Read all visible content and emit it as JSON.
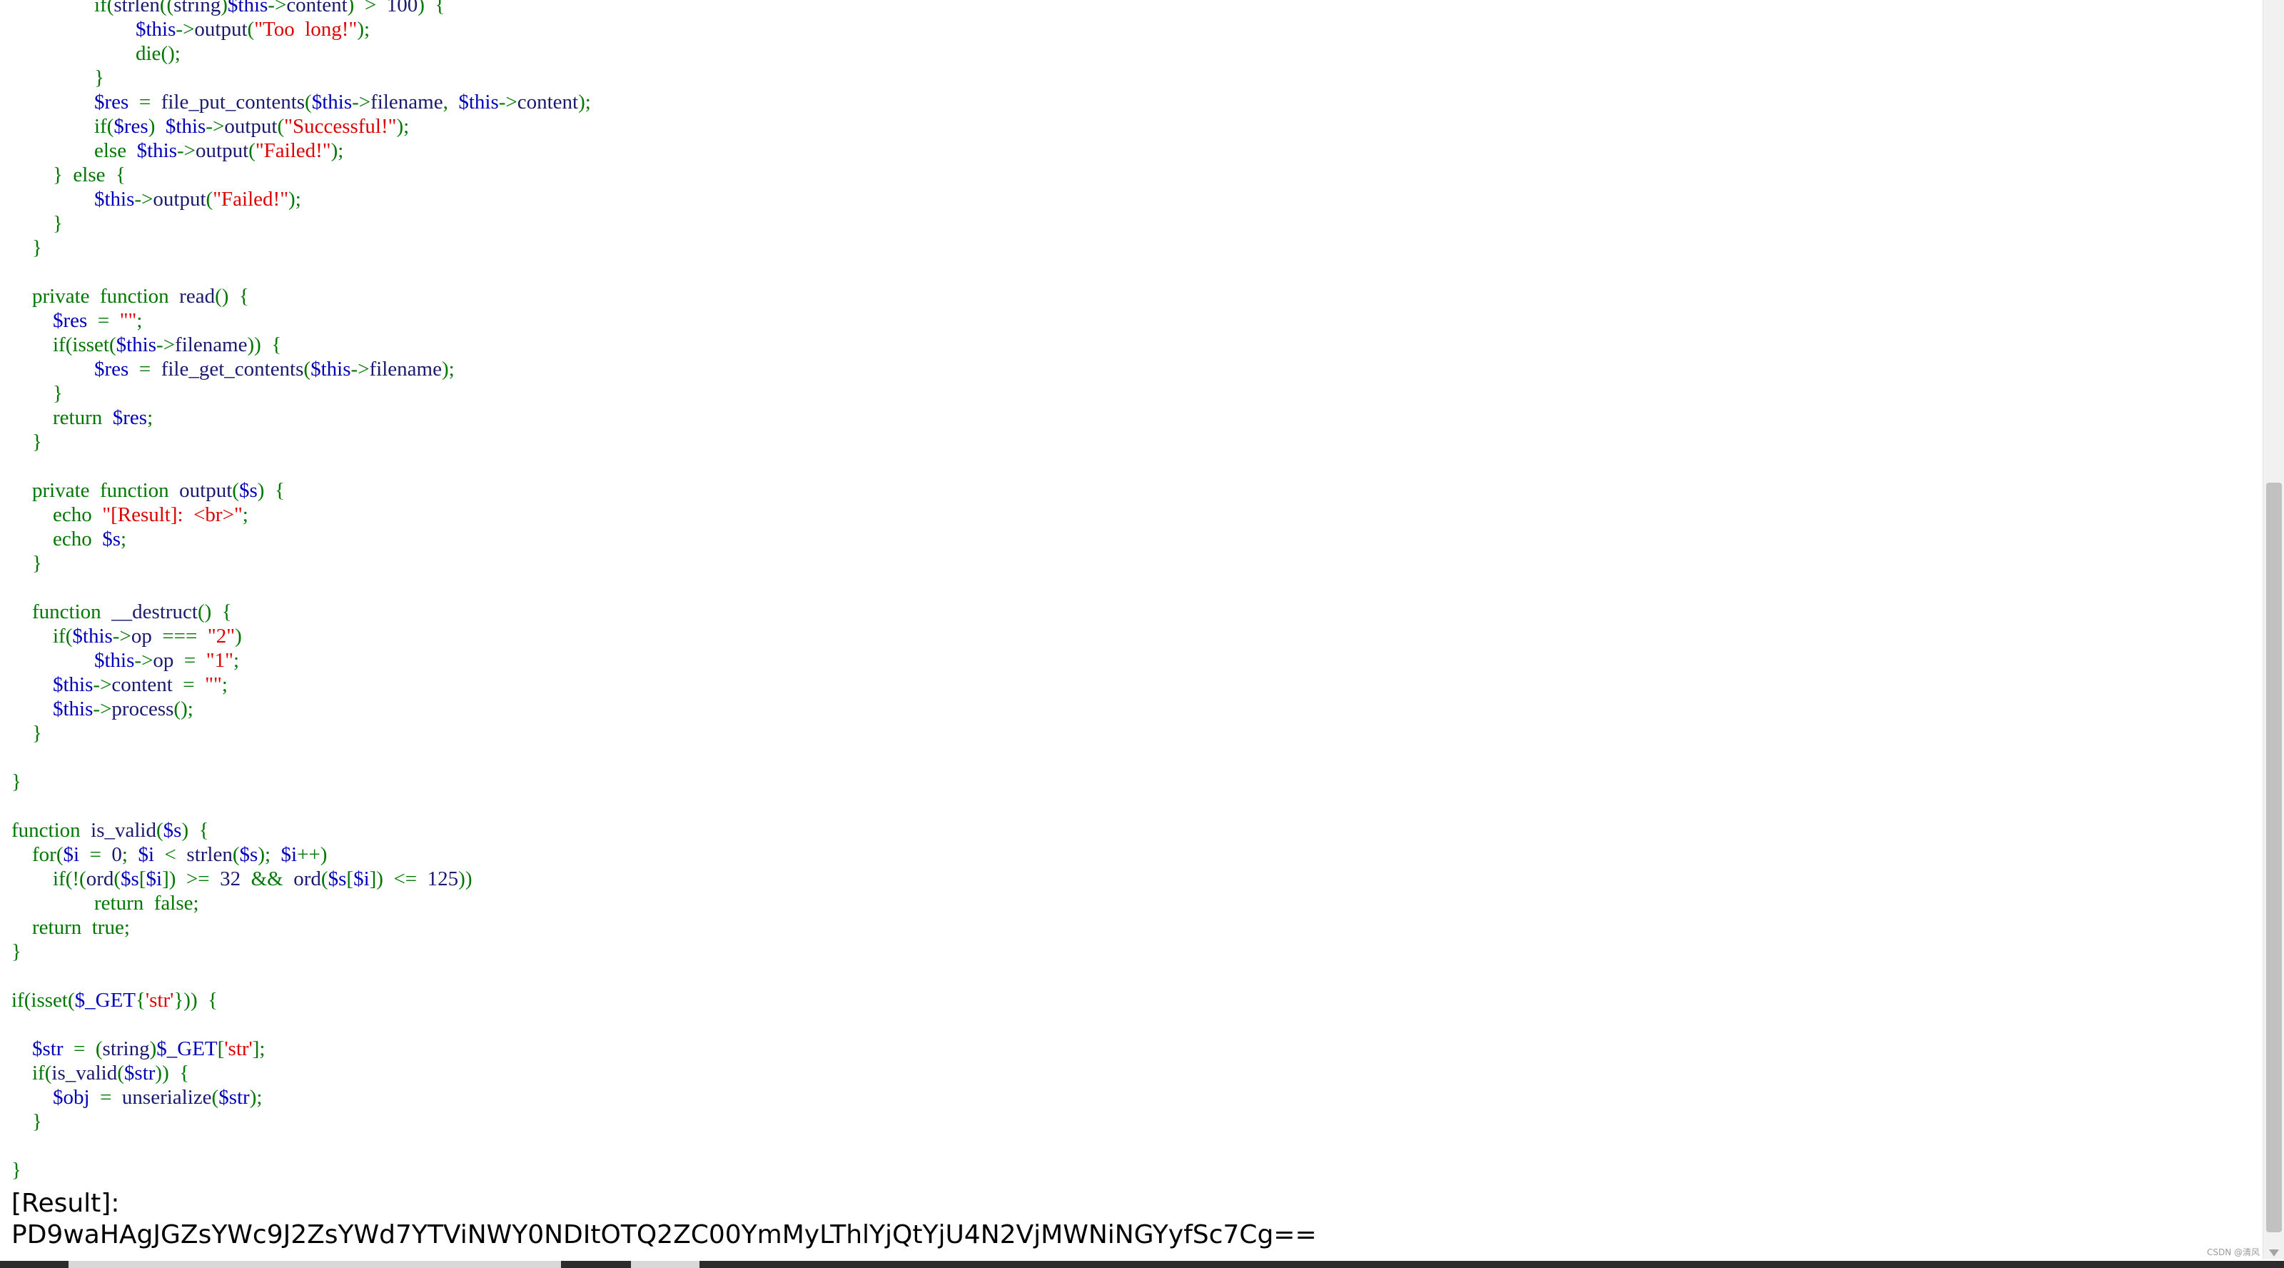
{
  "code_lines": [
    "                if(strlen((string)$this->content)  >  100)  {",
    "                        $this->output(\"Too  long!\");",
    "                        die();",
    "                }",
    "                $res  =  file_put_contents($this->filename,  $this->content);",
    "                if($res)  $this->output(\"Successful!\");",
    "                else  $this->output(\"Failed!\");",
    "        }  else  {",
    "                $this->output(\"Failed!\");",
    "        }",
    "    }",
    "",
    "    private  function  read()  {",
    "        $res  =  \"\";",
    "        if(isset($this->filename))  {",
    "                $res  =  file_get_contents($this->filename);",
    "        }",
    "        return  $res;",
    "    }",
    "",
    "    private  function  output($s)  {",
    "        echo  \"[Result]:  <br>\";",
    "        echo  $s;",
    "    }",
    "",
    "    function  __destruct()  {",
    "        if($this->op  ===  \"2\")",
    "                $this->op  =  \"1\";",
    "        $this->content  =  \"\";",
    "        $this->process();",
    "    }",
    "",
    "}",
    "",
    "function  is_valid($s)  {",
    "    for($i  =  0;  $i  <  strlen($s);  $i++)",
    "        if(!(ord($s[$i])  >=  32  &&  ord($s[$i])  <=  125))",
    "                return  false;",
    "    return  true;",
    "}",
    "",
    "if(isset($_GET{'str'}))  {",
    "",
    "    $str  =  (string)$_GET['str'];",
    "    if(is_valid($str))  {",
    "        $obj  =  unserialize($str);",
    "    }",
    "",
    "}"
  ],
  "result": {
    "label": "[Result]:",
    "value": "PD9waHAgJGZsYWc9J2ZsYWd7YTViNWY0NDItOTQ2ZC00YmMyLThlYjQtYjU4N2VjMWNiNGYyfSc7Cg=="
  },
  "watermark": "CSDN @清风"
}
